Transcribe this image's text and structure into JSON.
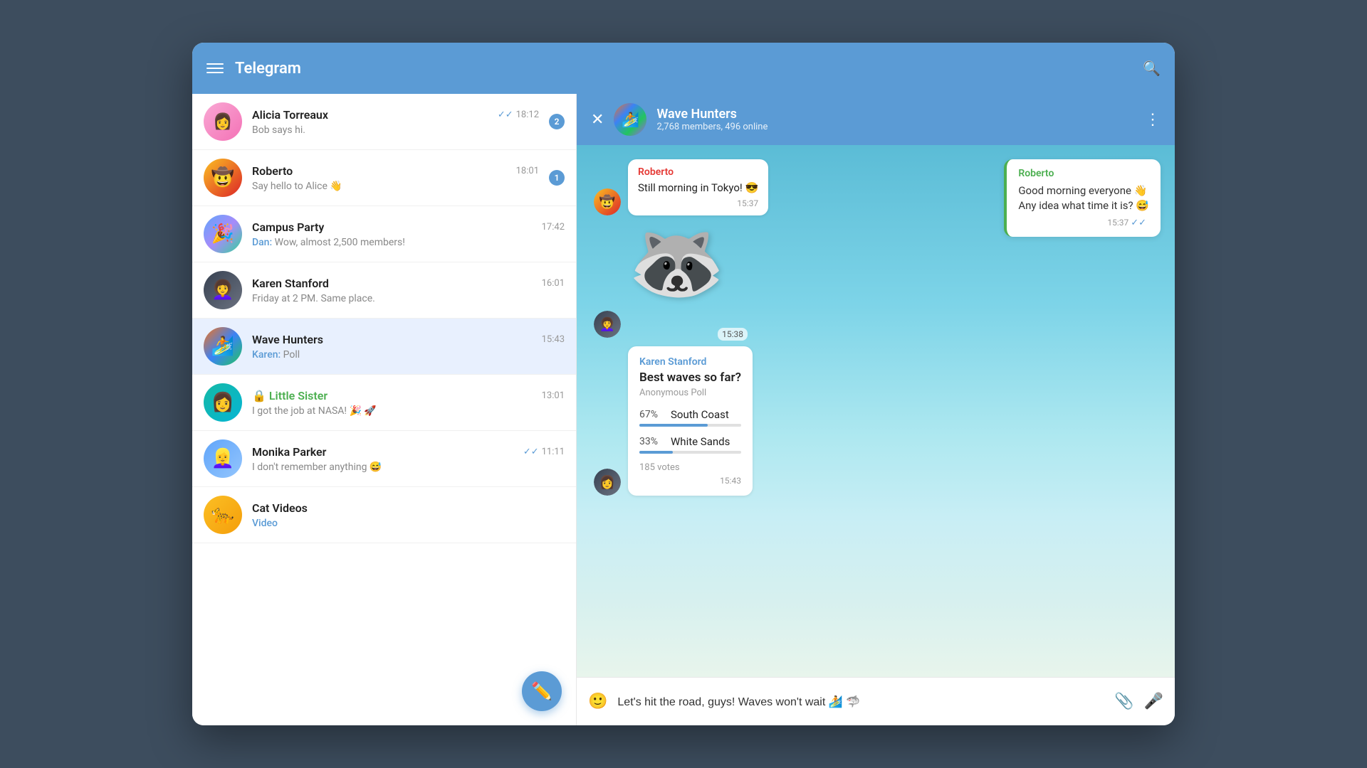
{
  "app": {
    "title": "Telegram",
    "header": {
      "search_icon": "🔍",
      "menu_icon": "☰"
    }
  },
  "sidebar": {
    "chats": [
      {
        "id": "alicia",
        "name": "Alicia Torreaux",
        "time": "18:12",
        "preview": "Bob says hi.",
        "badge": "2",
        "has_tick": true,
        "avatar_class": "av-alice",
        "avatar_emoji": "👩"
      },
      {
        "id": "roberto",
        "name": "Roberto",
        "time": "18:01",
        "preview": "Say hello to Alice 👋",
        "badge": "1",
        "has_tick": false,
        "avatar_class": "av-roberto",
        "avatar_emoji": "🤠"
      },
      {
        "id": "campus",
        "name": "Campus Party",
        "time": "17:42",
        "preview_sender": "Dan",
        "preview": "Wow, almost 2,500 members!",
        "avatar_class": "av-campus",
        "avatar_emoji": "🎉"
      },
      {
        "id": "karen",
        "name": "Karen Stanford",
        "time": "16:01",
        "preview": "Friday at 2 PM. Same place.",
        "avatar_class": "av-karen",
        "avatar_emoji": "👩‍🦱"
      },
      {
        "id": "wavehunters",
        "name": "Wave Hunters",
        "time": "15:43",
        "preview_sender": "Karen",
        "preview": "Poll",
        "avatar_class": "av-wavehunters",
        "avatar_emoji": "🏄",
        "active": true
      },
      {
        "id": "littlesister",
        "name": "Little Sister",
        "time": "13:01",
        "preview": "I got the job at NASA! 🎉 🚀",
        "is_locked": true,
        "avatar_class": "av-littlesister",
        "avatar_emoji": "👩"
      },
      {
        "id": "monika",
        "name": "Monika Parker",
        "time": "11:11",
        "preview": "I don't remember anything 😅",
        "has_tick": true,
        "avatar_class": "av-monika",
        "avatar_emoji": "👱‍♀️"
      },
      {
        "id": "catvideos",
        "name": "Cat Videos",
        "time": "",
        "preview_sender": "",
        "preview": "Video",
        "preview_is_link": true,
        "avatar_class": "av-catvideos",
        "avatar_emoji": "🐆"
      }
    ],
    "fab_icon": "✏️"
  },
  "chat": {
    "group_name": "Wave Hunters",
    "group_meta": "2,768 members, 496 online",
    "messages": [
      {
        "id": "m1",
        "type": "bubble",
        "sender": "Roberto",
        "sender_class": "roberto",
        "text": "Still morning in Tokyo! 😎",
        "time": "15:37",
        "avatar_class": "av-roberto-msg",
        "avatar_emoji": "🤠"
      },
      {
        "id": "m2",
        "type": "sticker",
        "emoji": "🦝",
        "time": "15:38",
        "avatar_class": "av-karen-msg",
        "avatar_emoji": "👩‍🦱"
      },
      {
        "id": "m3",
        "type": "poll",
        "sender": "Karen Stanford",
        "sender_class": "karen",
        "poll_title": "Best waves so far?",
        "poll_sub": "Anonymous Poll",
        "options": [
          {
            "label": "South Coast",
            "pct": 67,
            "pct_text": "67%"
          },
          {
            "label": "White Sands",
            "pct": 33,
            "pct_text": "33%"
          }
        ],
        "votes": "185 votes",
        "time": "15:43",
        "avatar_class": "av-karen-msg",
        "avatar_emoji": "👩"
      }
    ],
    "quoted": {
      "sender": "Roberto",
      "text": "Good morning everyone 👋\nAny idea what time it is? 😅",
      "time": "15:37"
    },
    "input_placeholder": "Let's hit the road, guys! Waves won't wait 🏄 🦈"
  }
}
